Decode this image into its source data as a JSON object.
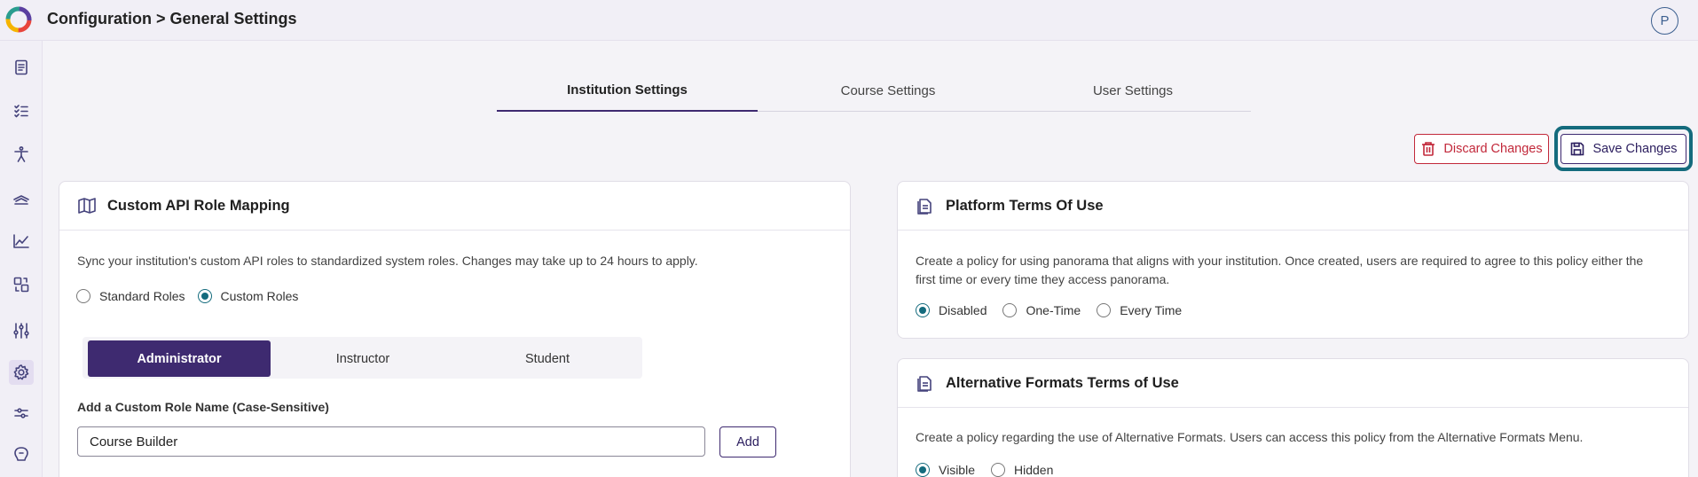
{
  "header": {
    "title": "Configuration > General Settings",
    "avatar_initial": "P"
  },
  "sidebar": {
    "items": [
      {
        "icon": "document-icon"
      },
      {
        "icon": "checklist-icon"
      },
      {
        "icon": "accessibility-icon"
      },
      {
        "icon": "graduation-icon"
      },
      {
        "icon": "analytics-icon"
      },
      {
        "icon": "conversion-icon"
      },
      {
        "icon": "sliders-icon"
      },
      {
        "icon": "gear-icon",
        "active": true
      },
      {
        "icon": "adjustments-icon"
      },
      {
        "icon": "ai-icon"
      }
    ]
  },
  "tabs": [
    {
      "label": "Institution Settings",
      "active": true
    },
    {
      "label": "Course Settings",
      "active": false
    },
    {
      "label": "User Settings",
      "active": false
    }
  ],
  "actions": {
    "discard_label": "Discard Changes",
    "save_label": "Save Changes"
  },
  "role_mapping": {
    "title": "Custom API Role Mapping",
    "description": "Sync your institution's custom API roles to standardized system roles. Changes may take up to 24 hours to apply.",
    "role_type_options": [
      {
        "label": "Standard Roles",
        "checked": false
      },
      {
        "label": "Custom Roles",
        "checked": true
      }
    ],
    "roles": [
      {
        "label": "Administrator",
        "active": true
      },
      {
        "label": "Instructor",
        "active": false
      },
      {
        "label": "Student",
        "active": false
      }
    ],
    "field_label": "Add a Custom Role Name (Case-Sensitive)",
    "field_value": "Course Builder",
    "add_label": "Add"
  },
  "platform_terms": {
    "title": "Platform Terms Of Use",
    "description_line1": "Create a policy for using panorama that aligns with your institution. Once created, users are required to agree to this policy either the",
    "description_line2": "first time or every time they access panorama.",
    "options": [
      {
        "label": "Disabled",
        "checked": true
      },
      {
        "label": "One-Time",
        "checked": false
      },
      {
        "label": "Every Time",
        "checked": false
      }
    ]
  },
  "alt_formats_terms": {
    "title": "Alternative Formats Terms of Use",
    "description": "Create a policy regarding the use of Alternative Formats. Users can access this policy from the Alternative Formats Menu.",
    "options": [
      {
        "label": "Visible",
        "checked": true
      },
      {
        "label": "Hidden",
        "checked": false
      }
    ]
  },
  "colors": {
    "accent": "#3e2a70",
    "teal": "#146b7d",
    "danger": "#c2283a"
  }
}
